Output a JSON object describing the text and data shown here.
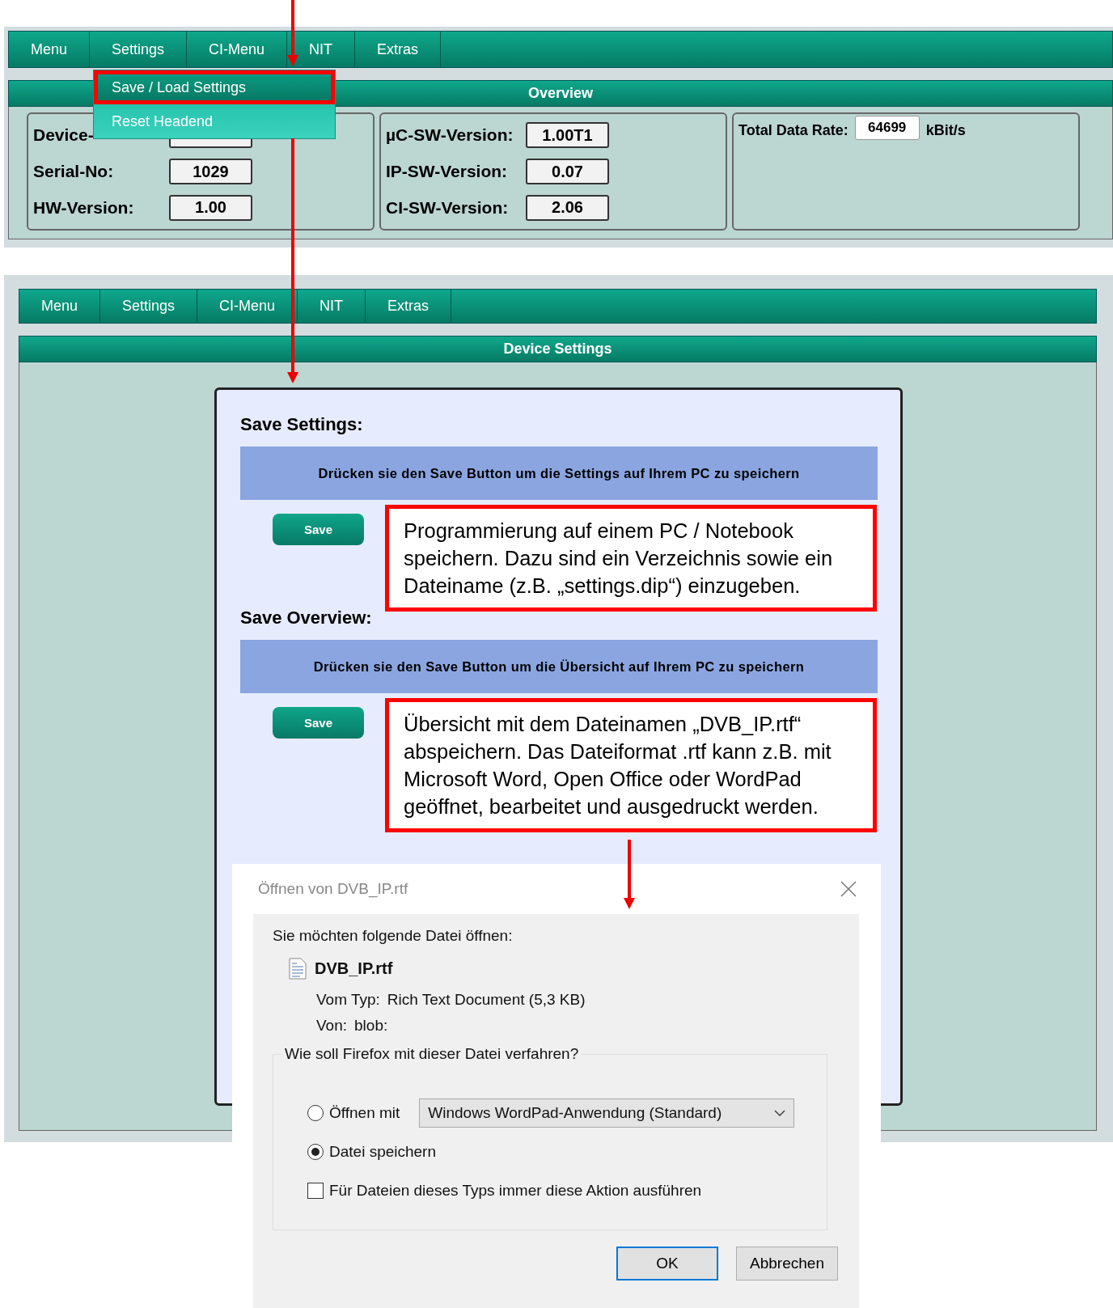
{
  "top_screen": {
    "menu": [
      {
        "label": "Menu"
      },
      {
        "label": "Settings"
      },
      {
        "label": "CI-Menu"
      },
      {
        "label": "NIT"
      },
      {
        "label": "Extras"
      }
    ],
    "dropdown": [
      {
        "label": "Save / Load Settings",
        "selected": true
      },
      {
        "label": "Reset Headend",
        "selected": false
      }
    ],
    "panel_title": "Overview",
    "groups": [
      {
        "fields": [
          {
            "label": "Device-"
          },
          {
            "label": "Serial-No:",
            "value": "1029"
          },
          {
            "label": "HW-Version:",
            "value": "1.00"
          }
        ]
      },
      {
        "fields": [
          {
            "label": "µC-SW-Version:",
            "value": "1.00T1"
          },
          {
            "label": "IP-SW-Version:",
            "value": "0.07"
          },
          {
            "label": "CI-SW-Version:",
            "value": "2.06"
          }
        ]
      },
      {
        "fields": [
          {
            "label": "Total Data Rate:",
            "value": "64699",
            "unit": "kBit/s"
          }
        ]
      }
    ]
  },
  "bottom_screen": {
    "menu": [
      {
        "label": "Menu"
      },
      {
        "label": "Settings"
      },
      {
        "label": "CI-Menu"
      },
      {
        "label": "NIT"
      },
      {
        "label": "Extras"
      }
    ],
    "panel_title": "Device Settings",
    "sections": [
      {
        "heading": "Save Settings:",
        "instruction": "Drücken sie den Save Button um die Settings auf Ihrem PC zu speichern",
        "button": "Save",
        "note": "Programmierung auf einem PC / Notebook speichern. Dazu sind ein Verzeichnis sowie ein Dateiname (z.B. „settings.dip“) einzugeben."
      },
      {
        "heading": "Save Overview:",
        "instruction": "Drücken sie den Save Button um die Übersicht auf Ihrem PC zu speichern",
        "button": "Save",
        "note": "Übersicht mit dem Dateinamen „DVB_IP.rtf“ abspeichern. Das Dateiformat .rtf kann z.B. mit Microsoft Word, Open Office oder WordPad geöffnet, bearbeitet und ausgedruckt werden."
      }
    ]
  },
  "dialog": {
    "title": "Öffnen von DVB_IP.rtf",
    "prompt": "Sie möchten folgende Datei öffnen:",
    "file_name": "DVB_IP.rtf",
    "type_label": "Vom Typ:",
    "type_value": "Rich Text Document (5,3 KB)",
    "from_label": "Von:",
    "from_value": "blob:",
    "question": "Wie soll Firefox mit dieser Datei verfahren?",
    "options": [
      {
        "kind": "radio",
        "label": "Öffnen mit",
        "selected": false,
        "app": "Windows WordPad-Anwendung (Standard)"
      },
      {
        "kind": "radio",
        "label": "Datei speichern",
        "selected": true
      },
      {
        "kind": "checkbox",
        "label": "Für Dateien dieses Typs immer diese Aktion ausführen",
        "checked": false
      }
    ],
    "buttons": [
      {
        "label": "OK",
        "default": true
      },
      {
        "label": "Abbrechen",
        "default": false
      }
    ]
  }
}
